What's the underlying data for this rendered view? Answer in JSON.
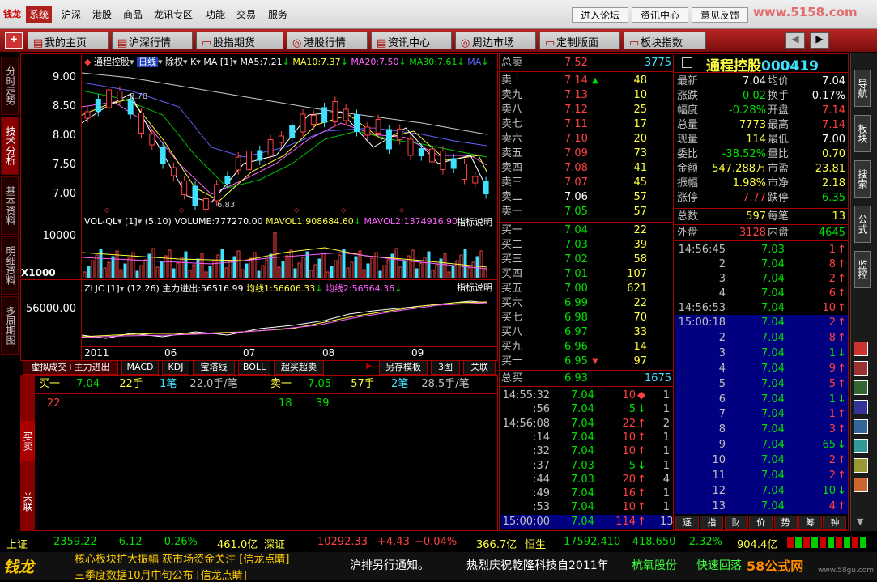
{
  "menubar": {
    "logo": "钱龙",
    "items": [
      "系统",
      "沪深",
      "港股",
      "商品",
      "龙讯专区",
      "功能",
      "交易",
      "服务"
    ],
    "right": [
      "进入论坛",
      "资讯中心",
      "意见反馈"
    ],
    "watermark": "www.5158.com"
  },
  "toolbar": [
    "我的主页",
    "沪深行情",
    "股指期货",
    "港股行情",
    "资讯中心",
    "周边市场",
    "定制版面",
    "板块指数"
  ],
  "left_tabs": [
    "分时走势",
    "技术分析",
    "基本资料",
    "明细资料",
    "多周期图"
  ],
  "kchart": {
    "header": [
      "通程控股",
      "日线",
      "除权",
      "K",
      "MA",
      "[1]",
      "MA5:7.21",
      "MA10:7.37",
      "MA20:7.50",
      "MA30:7.61",
      "MA"
    ],
    "y_labels": [
      "9.00",
      "8.50",
      "8.00",
      "7.50",
      "7.00"
    ],
    "hi_label": "8.78",
    "lo_label": "6.83"
  },
  "volchart": {
    "header": [
      "VOL-QL",
      "[1]",
      "(5,10)",
      "VOLUME:777270.00",
      "MAVOL1:908684.60",
      "MAVOL2:1374916.90"
    ],
    "explain": "指标说明",
    "y_label": "10000",
    "unit": "X1000"
  },
  "zljc": {
    "header": [
      "ZLJC",
      "[1]",
      "(12,26)",
      "主力进出:56516.99",
      "均线1:56606.33",
      "均线2:56564.36"
    ],
    "explain": "指标说明",
    "y_label": "56000.00"
  },
  "x_labels": [
    "2011",
    "06",
    "07",
    "08",
    "09"
  ],
  "bottom_tabs": [
    "虚拟成交+主力进出",
    "MACD",
    "KDJ",
    "宝塔线",
    "BOLL",
    "超买超卖",
    "另存模板",
    "3图",
    "关联"
  ],
  "left_small_tabs": [
    "买卖",
    "关联"
  ],
  "trade_left": {
    "label": "买一",
    "price": "7.04",
    "vol": "22手",
    "count": "1笔",
    "avg": "22.0手/笔",
    "detail": [
      "22"
    ]
  },
  "trade_right": {
    "label": "卖一",
    "price": "7.05",
    "vol": "57手",
    "count": "2笔",
    "avg": "28.5手/笔",
    "detail": [
      "18",
      "39"
    ]
  },
  "orderbook": {
    "sell_total": {
      "label": "总卖",
      "price": "7.52",
      "vol": "3775"
    },
    "sells": [
      [
        "卖十",
        "7.14",
        "48"
      ],
      [
        "卖九",
        "7.13",
        "10"
      ],
      [
        "卖八",
        "7.12",
        "25"
      ],
      [
        "卖七",
        "7.11",
        "17"
      ],
      [
        "卖六",
        "7.10",
        "20"
      ],
      [
        "卖五",
        "7.09",
        "73"
      ],
      [
        "卖四",
        "7.08",
        "41"
      ],
      [
        "卖三",
        "7.07",
        "45"
      ],
      [
        "卖二",
        "7.06",
        "57"
      ],
      [
        "卖一",
        "7.05",
        "57"
      ]
    ],
    "buys": [
      [
        "买一",
        "7.04",
        "22"
      ],
      [
        "买二",
        "7.03",
        "39"
      ],
      [
        "买三",
        "7.02",
        "58"
      ],
      [
        "买四",
        "7.01",
        "107"
      ],
      [
        "买五",
        "7.00",
        "621"
      ],
      [
        "买六",
        "6.99",
        "22"
      ],
      [
        "买七",
        "6.98",
        "70"
      ],
      [
        "买八",
        "6.97",
        "33"
      ],
      [
        "买九",
        "6.96",
        "14"
      ],
      [
        "买十",
        "6.95",
        "97"
      ]
    ],
    "buy_total": {
      "label": "总买",
      "price": "6.93",
      "vol": "1675"
    }
  },
  "ticks_mid": [
    [
      "14:55:32",
      "7.04",
      "10",
      "1"
    ],
    [
      ":56",
      "7.04",
      "5",
      "1"
    ],
    [
      "14:56:08",
      "7.04",
      "22",
      "2"
    ],
    [
      ":14",
      "7.04",
      "10",
      "1"
    ],
    [
      ":32",
      "7.04",
      "10",
      "1"
    ],
    [
      ":37",
      "7.03",
      "5",
      "1"
    ],
    [
      ":44",
      "7.03",
      "20",
      "4"
    ],
    [
      ":49",
      "7.04",
      "16",
      "1"
    ],
    [
      ":53",
      "7.04",
      "10",
      "1"
    ],
    [
      "15:00:00",
      "7.04",
      "114",
      "13"
    ]
  ],
  "stock": {
    "name": "通程控股",
    "code": "000419"
  },
  "quote": [
    [
      "最新",
      "7.04",
      "均价",
      "7.04"
    ],
    [
      "涨跌",
      "-0.02",
      "换手",
      "0.17%"
    ],
    [
      "幅度",
      "-0.28%",
      "开盘",
      "7.14"
    ],
    [
      "总量",
      "7773",
      "最高",
      "7.14"
    ],
    [
      "现量",
      "114",
      "最低",
      "7.00"
    ],
    [
      "委比",
      "-38.52%",
      "量比",
      "0.70"
    ],
    [
      "金额",
      "547.288万",
      "市盈",
      "23.81"
    ],
    [
      "振幅",
      "1.98%",
      "市净",
      "2.18"
    ],
    [
      "涨停",
      "7.77",
      "跌停",
      "6.35"
    ]
  ],
  "counts": {
    "zongshu_l": "总数",
    "zongshu_v": "597",
    "meibi_l": "每笔",
    "meibi_v": "13",
    "waipan_l": "外盘",
    "waipan_v": "3128",
    "neipan_l": "内盘",
    "neipan_v": "4645"
  },
  "ticks_right_top": [
    [
      "14:56:45",
      "7.03",
      "1"
    ],
    [
      "2",
      "7.04",
      "8"
    ],
    [
      "3",
      "7.04",
      "2"
    ],
    [
      "4",
      "7.04",
      "6"
    ],
    [
      "14:56:53",
      "7.04",
      "10"
    ]
  ],
  "ticks_right": [
    [
      "15:00:18",
      "7.04",
      "2"
    ],
    [
      "2",
      "7.04",
      "8"
    ],
    [
      "3",
      "7.04",
      "1"
    ],
    [
      "4",
      "7.04",
      "9"
    ],
    [
      "5",
      "7.04",
      "5"
    ],
    [
      "6",
      "7.04",
      "1"
    ],
    [
      "7",
      "7.04",
      "1"
    ],
    [
      "8",
      "7.04",
      "3"
    ],
    [
      "9",
      "7.04",
      "65"
    ],
    [
      "10",
      "7.04",
      "2"
    ],
    [
      "11",
      "7.04",
      "2"
    ],
    [
      "12",
      "7.04",
      "10"
    ],
    [
      "13",
      "7.04",
      "4"
    ]
  ],
  "right_btns": [
    "逐",
    "指",
    "财",
    "价",
    "势",
    "筹",
    "钟"
  ],
  "right_tabs": [
    "导航",
    "板块",
    "搜索",
    "公式",
    "监控"
  ],
  "status": [
    {
      "name": "上证",
      "price": "2359.22",
      "chg": "-6.12",
      "pct": "-0.26%",
      "amt": "461.0亿"
    },
    {
      "name": "深证",
      "price": "10292.33",
      "chg": "+4.43",
      "pct": "+0.04%",
      "amt": "366.7亿"
    },
    {
      "name": "恒生",
      "price": "17592.410",
      "chg": "-418.650",
      "pct": "-2.32%",
      "amt": "904.4亿"
    }
  ],
  "ticker": {
    "logo": "钱龙",
    "left1": "核心板块扩大振幅 获市场资金关注 [信龙点睛]",
    "left2": "三季度数据10月中旬公布 [信龙点睛]",
    "mid": "沪排另行通知。",
    "right": "热烈庆祝乾隆科技自2011年",
    "s1": "杭氧股份",
    "s2": "快速回落",
    "site": "58公式网",
    "url": "www.58gu.com"
  },
  "colors": {
    "up": "#ff4040",
    "down": "#00e000",
    "flat": "#ffffff",
    "accent": "#a00000",
    "highlight": "#000080"
  }
}
